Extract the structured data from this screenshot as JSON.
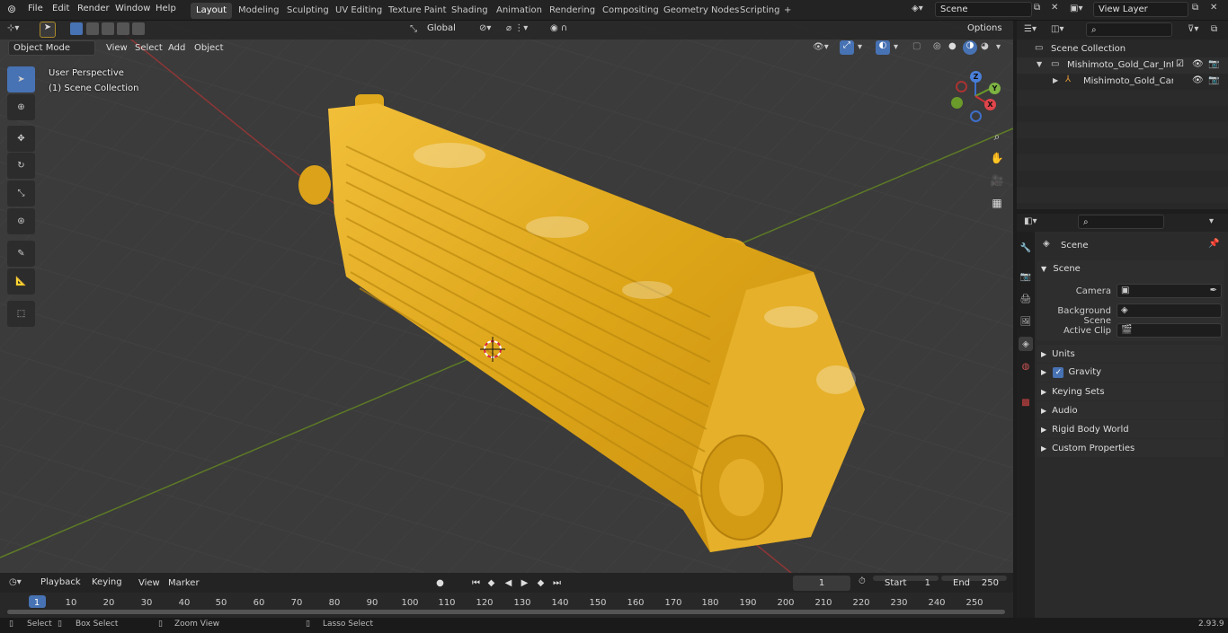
{
  "topbar": {
    "menus": [
      "File",
      "Edit",
      "Render",
      "Window",
      "Help"
    ],
    "workspaces": [
      "Layout",
      "Modeling",
      "Sculpting",
      "UV Editing",
      "Texture Paint",
      "Shading",
      "Animation",
      "Rendering",
      "Compositing",
      "Geometry Nodes",
      "Scripting"
    ],
    "active_workspace": "Layout",
    "add_workspace": "+",
    "scene_name": "Scene",
    "view_layer": "View Layer"
  },
  "viewport": {
    "mode": "Object Mode",
    "menus": [
      "View",
      "Select",
      "Add",
      "Object"
    ],
    "transform_orientation": "Global",
    "options_label": "Options",
    "info_line1": "User Perspective",
    "info_line2": "(1) Scene Collection",
    "gizmo": {
      "x": "X",
      "y": "Y",
      "z": "Z"
    }
  },
  "toolbar": {
    "tools": [
      "select-box",
      "cursor",
      "move",
      "rotate",
      "scale",
      "transform",
      "annotate",
      "measure",
      "add-cube"
    ]
  },
  "outliner": {
    "root": "Scene Collection",
    "collection": "Mishimoto_Gold_Car_Intercoo",
    "object": "Mishimoto_Gold_Car_Inte"
  },
  "properties": {
    "context": "Scene",
    "panel_title": "Scene",
    "camera_label": "Camera",
    "bg_scene_label": "Background Scene",
    "active_clip_label": "Active Clip",
    "sections": [
      "Units",
      "Gravity",
      "Keying Sets",
      "Audio",
      "Rigid Body World",
      "Custom Properties"
    ],
    "gravity_checked": true
  },
  "timeline": {
    "menus": [
      "Playback",
      "Keying",
      "View",
      "Marker"
    ],
    "current_frame": "1",
    "start_label": "Start",
    "start_value": "1",
    "end_label": "End",
    "end_value": "250",
    "ruler": [
      "1",
      "10",
      "20",
      "30",
      "40",
      "50",
      "60",
      "70",
      "80",
      "90",
      "100",
      "110",
      "120",
      "130",
      "140",
      "150",
      "160",
      "170",
      "180",
      "190",
      "200",
      "210",
      "220",
      "230",
      "240",
      "250"
    ]
  },
  "statusbar": {
    "select": "Select",
    "box_select": "Box Select",
    "zoom_view": "Zoom View",
    "lasso_select": "Lasso Select",
    "version": "2.93.9"
  },
  "colors": {
    "accent": "#4772b3",
    "model_gold": "#e3a81e",
    "x_axis": "#a83a3a",
    "y_axis": "#6a8a2a"
  }
}
